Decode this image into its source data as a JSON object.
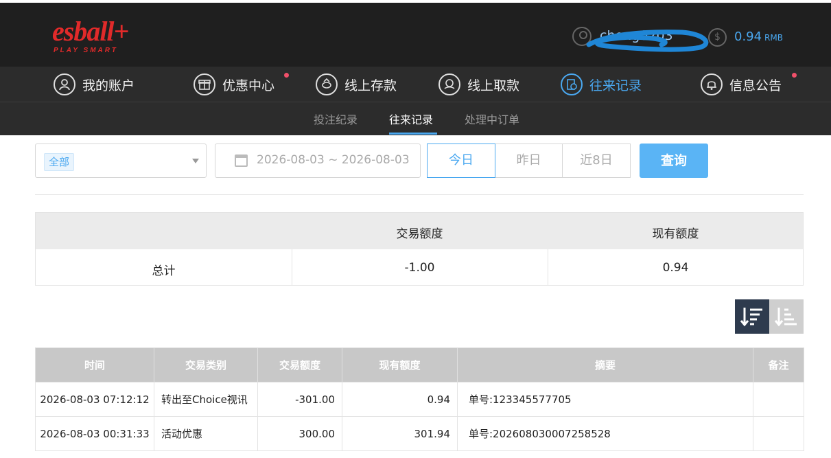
{
  "header": {
    "brand": "esball+",
    "tagline": "PLAY SMART",
    "username": "cheng0203",
    "balance": "0.94",
    "currency": "RMB",
    "accent_color": "#4aa8f0",
    "brand_color": "#e12a2a"
  },
  "main_nav": [
    {
      "label": "我的账户",
      "icon": "user-icon",
      "active": false,
      "dot": false
    },
    {
      "label": "优惠中心",
      "icon": "gift-icon",
      "active": false,
      "dot": true
    },
    {
      "label": "线上存款",
      "icon": "deposit-icon",
      "active": false,
      "dot": false
    },
    {
      "label": "线上取款",
      "icon": "withdraw-icon",
      "active": false,
      "dot": false
    },
    {
      "label": "往来记录",
      "icon": "records-icon",
      "active": true,
      "dot": false
    },
    {
      "label": "信息公告",
      "icon": "bell-icon",
      "active": false,
      "dot": true
    }
  ],
  "sub_nav": [
    {
      "label": "投注纪录",
      "active": false
    },
    {
      "label": "往来记录",
      "active": true
    },
    {
      "label": "处理中订单",
      "active": false
    }
  ],
  "filters": {
    "type_value": "全部",
    "date_range": "2026-08-03 ~ 2026-08-03",
    "ranges": [
      "今日",
      "昨日",
      "近8日"
    ],
    "query_label": "查询"
  },
  "summary": {
    "headers": [
      "交易额度",
      "现有额度"
    ],
    "row_label": "总计",
    "transaction_total": "-1.00",
    "current_total": "0.94"
  },
  "table": {
    "columns": [
      "时间",
      "交易类别",
      "交易额度",
      "现有额度",
      "摘要",
      "备注"
    ],
    "rows": [
      {
        "time": "2026-08-03 07:12:12",
        "type": "转出至Choice视讯",
        "amount": "-301.00",
        "balance": "0.94",
        "summary": "单号:123345577705",
        "note": ""
      },
      {
        "time": "2026-08-03 00:31:33",
        "type": "活动优惠",
        "amount": "300.00",
        "balance": "301.94",
        "summary": "单号:202608030007258528",
        "note": ""
      }
    ]
  }
}
